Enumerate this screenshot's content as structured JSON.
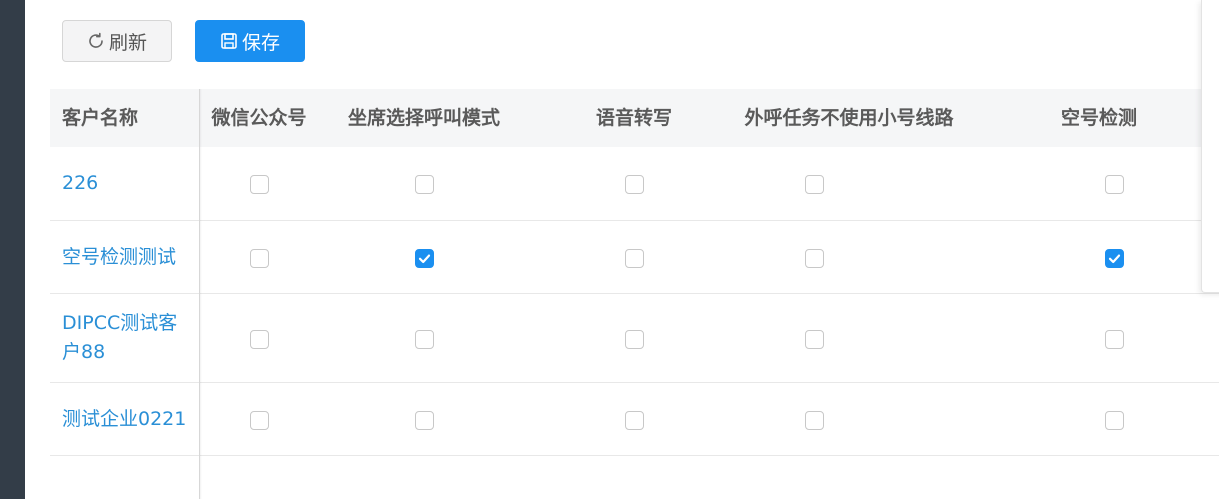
{
  "toolbar": {
    "refresh_label": "刷新",
    "save_label": "保存"
  },
  "table": {
    "columns": [
      "客户名称",
      "微信公众号",
      "坐席选择呼叫模式",
      "语音转写",
      "外呼任务不使用小号线路",
      "空号检测"
    ],
    "rows": [
      {
        "name": "226",
        "checks": [
          false,
          false,
          false,
          false,
          false
        ]
      },
      {
        "name": "空号检测测试",
        "checks": [
          false,
          true,
          false,
          false,
          true
        ]
      },
      {
        "name": "DIPCC测试客户88",
        "checks": [
          false,
          false,
          false,
          false,
          false
        ]
      },
      {
        "name": "测试企业0221",
        "checks": [
          false,
          false,
          false,
          false,
          false
        ]
      }
    ]
  },
  "colors": {
    "accent": "#1a8ff0",
    "link": "#2a8fd6",
    "sidebar": "#333d48"
  }
}
